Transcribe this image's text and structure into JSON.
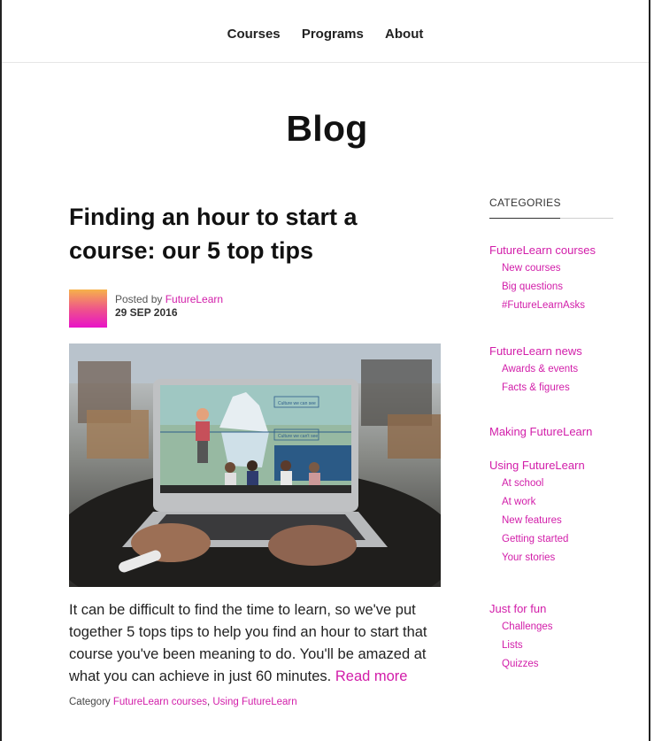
{
  "nav": {
    "items": [
      "Courses",
      "Programs",
      "About"
    ]
  },
  "page_title": "Blog",
  "post": {
    "title": "Finding an hour to start a course: our 5 top tips",
    "posted_by_prefix": "Posted by ",
    "author": "FutureLearn",
    "date": "29 SEP 2016",
    "excerpt": "It can be difficult to find the time to learn, so we've put together 5 tops tips to help you find an hour to start that course you've been meaning to do. You'll be amazed at what you can achieve in just 60 minutes.",
    "read_more": "Read more",
    "category_prefix": "Category ",
    "categories": [
      "FutureLearn courses",
      "Using FutureLearn"
    ],
    "category_separator": ", ",
    "image_labels": [
      "Culture we can see",
      "Culture we can't see"
    ]
  },
  "sidebar": {
    "heading": "CATEGORIES",
    "groups": [
      {
        "label": "FutureLearn courses",
        "children": [
          "New courses",
          "Big questions",
          "#FutureLearnAsks"
        ]
      },
      {
        "label": "FutureLearn news",
        "children": [
          "Awards & events",
          "Facts & figures"
        ]
      },
      {
        "label": "Making FutureLearn",
        "children": []
      },
      {
        "label": "Using FutureLearn",
        "children": [
          "At school",
          "At work",
          "New features",
          "Getting started",
          "Your stories"
        ]
      },
      {
        "label": "Just for fun",
        "children": [
          "Challenges",
          "Lists",
          "Quizzes"
        ]
      }
    ]
  },
  "colors": {
    "accent": "#d21da9",
    "text": "#1a1a1a"
  }
}
